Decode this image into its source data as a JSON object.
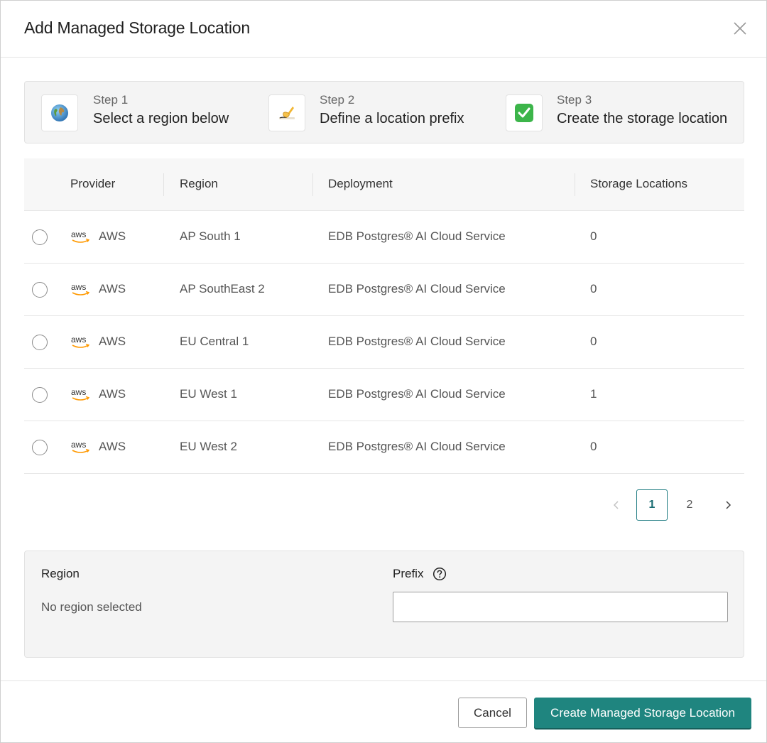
{
  "modal": {
    "title": "Add Managed Storage Location"
  },
  "steps": [
    {
      "number": "Step 1",
      "text": "Select a region below",
      "icon": "globe-icon"
    },
    {
      "number": "Step 2",
      "text": "Define a location prefix",
      "icon": "writing-hand-icon"
    },
    {
      "number": "Step 3",
      "text": "Create the storage location",
      "icon": "check-mark-icon"
    }
  ],
  "table": {
    "headers": {
      "provider": "Provider",
      "region": "Region",
      "deployment": "Deployment",
      "storage_locations": "Storage Locations"
    },
    "rows": [
      {
        "provider": "AWS",
        "region": "AP South 1",
        "deployment": "EDB Postgres® AI Cloud Service",
        "storage_locations": "0"
      },
      {
        "provider": "AWS",
        "region": "AP SouthEast 2",
        "deployment": "EDB Postgres® AI Cloud Service",
        "storage_locations": "0"
      },
      {
        "provider": "AWS",
        "region": "EU Central 1",
        "deployment": "EDB Postgres® AI Cloud Service",
        "storage_locations": "0"
      },
      {
        "provider": "AWS",
        "region": "EU West 1",
        "deployment": "EDB Postgres® AI Cloud Service",
        "storage_locations": "1"
      },
      {
        "provider": "AWS",
        "region": "EU West 2",
        "deployment": "EDB Postgres® AI Cloud Service",
        "storage_locations": "0"
      }
    ]
  },
  "pagination": {
    "pages": [
      "1",
      "2"
    ],
    "current": "1"
  },
  "form": {
    "region_label": "Region",
    "region_value": "No region selected",
    "prefix_label": "Prefix",
    "prefix_value": ""
  },
  "footer": {
    "cancel_label": "Cancel",
    "create_label": "Create Managed Storage Location"
  },
  "colors": {
    "primary": "#1f857f",
    "aws_orange": "#ff9900"
  }
}
